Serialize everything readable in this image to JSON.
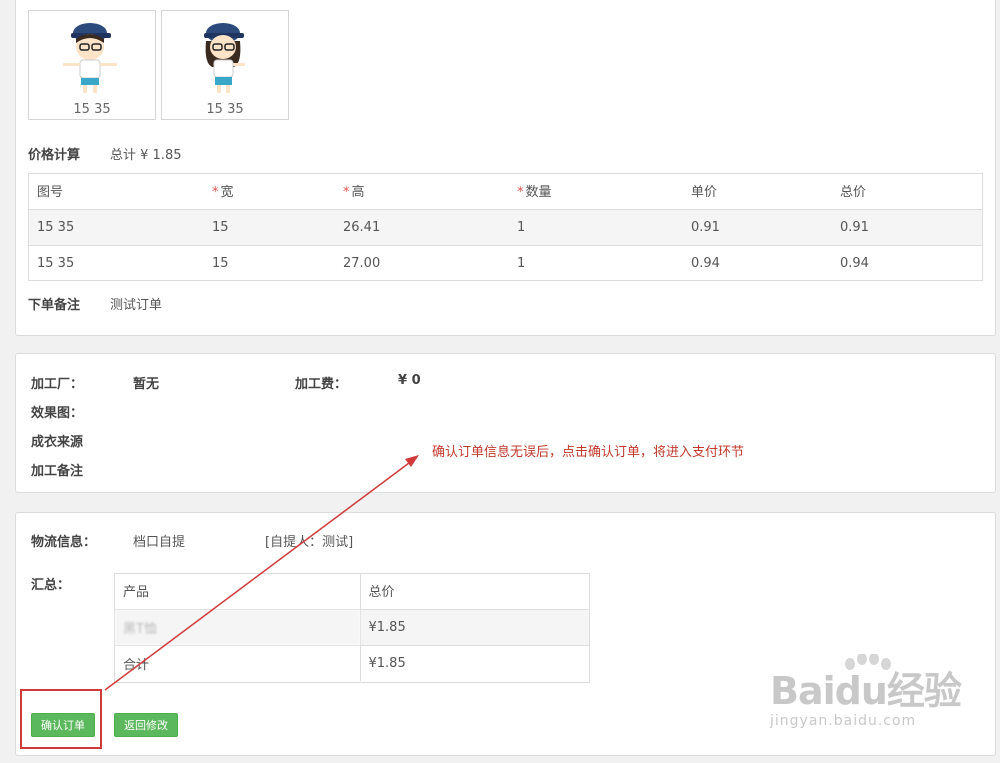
{
  "designs": [
    {
      "caption": "15 35"
    },
    {
      "caption": "15 35"
    }
  ],
  "price_calc": {
    "label": "价格计算",
    "total": "总计 ¥ 1.85",
    "headers": [
      "图号",
      "宽",
      "高",
      "数量",
      "单价",
      "总价"
    ],
    "required_marker": "*",
    "rows": [
      [
        "15 35",
        "15",
        "26.41",
        "1",
        "0.91",
        "0.91"
      ],
      [
        "15 35",
        "15",
        "27.00",
        "1",
        "0.94",
        "0.94"
      ]
    ]
  },
  "order_note": {
    "label": "下单备注",
    "value": "测试订单"
  },
  "processing": {
    "factory_label": "加工厂：",
    "factory_value": "暂无",
    "fee_label": "加工费：",
    "fee_value": "¥ 0",
    "effect_label": "效果图：",
    "source_label": "成衣来源",
    "note_label": "加工备注"
  },
  "annotation": "确认订单信息无误后，点击确认订单，将进入支付环节",
  "logistics": {
    "label": "物流信息：",
    "method": "档口自提",
    "pickup": "[自提人：测试]"
  },
  "summary": {
    "label": "汇总：",
    "headers": [
      "产品",
      "总价"
    ],
    "rows": [
      [
        "黑T恤",
        "¥1.85"
      ],
      [
        "合计",
        "¥1.85"
      ]
    ]
  },
  "buttons": {
    "confirm": "确认订单",
    "back": "返回修改"
  },
  "watermark": {
    "logo": "Baidu经验",
    "url": "jingyan.baidu.com"
  },
  "colors": {
    "primary_green": "#5cb85c",
    "annotation_red": "#d03a3a",
    "required_red": "#d9534f"
  }
}
